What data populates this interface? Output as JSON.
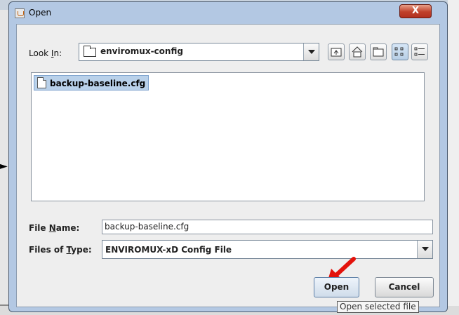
{
  "window": {
    "title": "Open",
    "close_glyph": "X"
  },
  "look_in": {
    "label_pre": "Look ",
    "label_key": "I",
    "label_post": "n:",
    "value": "enviromux-config",
    "icon": "folder-icon"
  },
  "toolbar": {
    "buttons": [
      {
        "name": "up-one-level-icon",
        "glyph": "⬏"
      },
      {
        "name": "home-icon",
        "glyph": "⌂"
      },
      {
        "name": "new-folder-icon",
        "glyph": "▭"
      },
      {
        "name": "list-view-icon",
        "glyph": "∷"
      },
      {
        "name": "details-view-icon",
        "glyph": "☰"
      }
    ]
  },
  "files": [
    {
      "name": "backup-baseline.cfg",
      "selected": true,
      "icon": "file-icon"
    }
  ],
  "file_name": {
    "label_pre": "File ",
    "label_key": "N",
    "label_post": "ame:",
    "value": "backup-baseline.cfg"
  },
  "file_type": {
    "label_pre": "Files of ",
    "label_key": "T",
    "label_post": "ype:",
    "value": "ENVIROMUX-xD Config File"
  },
  "buttons": {
    "open": "Open",
    "cancel": "Cancel"
  },
  "tooltip": "Open selected file",
  "colors": {
    "selection": "#b9d1ea",
    "annotation_arrow": "#e3120b",
    "title_bar": "#b3c8e3"
  }
}
